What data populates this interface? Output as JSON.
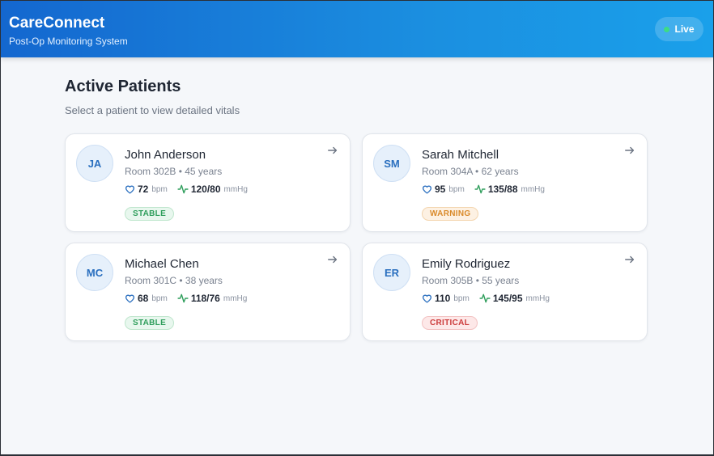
{
  "header": {
    "app_name": "CareConnect",
    "subtitle": "Post-Op Monitoring System",
    "live_label": "Live",
    "live_color": "#3ddc84"
  },
  "main": {
    "title": "Active Patients",
    "subtitle": "Select a patient to view detailed vitals"
  },
  "patients": [
    {
      "initials": "JA",
      "name": "John Anderson",
      "meta": "Room 302B • 45 years",
      "heart_rate": "72",
      "hr_unit": "bpm",
      "bp": "120/80",
      "bp_unit": "mmHg",
      "status": "STABLE"
    },
    {
      "initials": "SM",
      "name": "Sarah Mitchell",
      "meta": "Room 304A • 62 years",
      "heart_rate": "95",
      "hr_unit": "bpm",
      "bp": "135/88",
      "bp_unit": "mmHg",
      "status": "WARNING"
    },
    {
      "initials": "MC",
      "name": "Michael Chen",
      "meta": "Room 301C • 38 years",
      "heart_rate": "68",
      "hr_unit": "bpm",
      "bp": "118/76",
      "bp_unit": "mmHg",
      "status": "STABLE"
    },
    {
      "initials": "ER",
      "name": "Emily Rodriguez",
      "meta": "Room 305B • 55 years",
      "heart_rate": "110",
      "hr_unit": "bpm",
      "bp": "145/95",
      "bp_unit": "mmHg",
      "status": "CRITICAL"
    }
  ],
  "colors": {
    "brand_start": "#1467cf",
    "brand_end": "#1aa0ea",
    "stable": "#2f9e5c",
    "warning": "#d98a2b",
    "critical": "#cc3b3b"
  }
}
